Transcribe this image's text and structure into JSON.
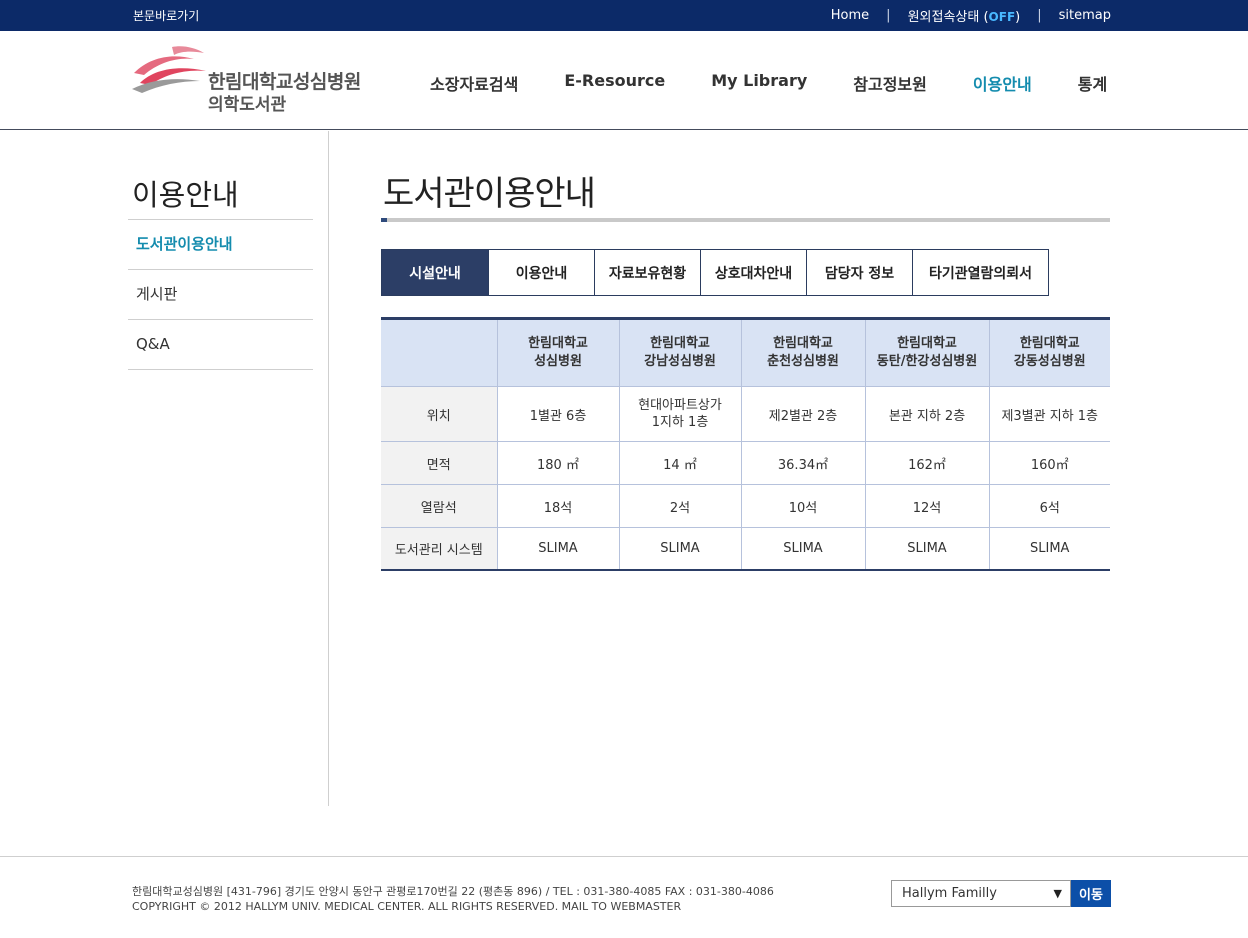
{
  "topbar": {
    "skip": "본문바로가기",
    "home": "Home",
    "remote_label": "원외접속상태",
    "remote_status": "OFF",
    "sitemap": "sitemap"
  },
  "logo": {
    "line1": "한림대학교성심병원",
    "line2": "의학도서관"
  },
  "gnb": [
    "소장자료검색",
    "E-Resource",
    "My Library",
    "참고정보원",
    "이용안내",
    "통계"
  ],
  "sidebar": {
    "title": "이용안내",
    "items": [
      "도서관이용안내",
      "게시판",
      "Q&A"
    ]
  },
  "content": {
    "title": "도서관이용안내",
    "tabs": [
      "시설안내",
      "이용안내",
      "자료보유현황",
      "상호대차안내",
      "담당자 정보",
      "타기관열람의뢰서"
    ]
  },
  "table": {
    "headers": [
      [
        "한림대학교",
        "성심병원"
      ],
      [
        "한림대학교",
        "강남성심병원"
      ],
      [
        "한림대학교",
        "춘천성심병원"
      ],
      [
        "한림대학교",
        "동탄/한강성심병원"
      ],
      [
        "한림대학교",
        "강동성심병원"
      ]
    ],
    "rows": [
      {
        "label": "위치",
        "cells": [
          "1별관 6층",
          "현대아파트상가\n1지하 1층",
          "제2별관 2층",
          "본관 지하 2층",
          "제3별관 지하 1층"
        ]
      },
      {
        "label": "면적",
        "cells": [
          "180 ㎡",
          "14 ㎡",
          "36.34㎡",
          "162㎡",
          "160㎡"
        ]
      },
      {
        "label": "열람석",
        "cells": [
          "18석",
          "2석",
          "10석",
          "12석",
          "6석"
        ]
      },
      {
        "label": "도서관리 시스템",
        "cells": [
          "SLIMA",
          "SLIMA",
          "SLIMA",
          "SLIMA",
          "SLIMA"
        ]
      }
    ]
  },
  "footer": {
    "address": "한림대학교성심병원 [431-796] 경기도 안양시 동안구 관평로170번길 22 (평촌동 896) / TEL : 031-380-4085 FAX : 031-380-4086",
    "copyright": "COPYRIGHT © 2012 HALLYM UNIV. MEDICAL CENTER. ALL RIGHTS RESERVED. MAIL TO WEBMASTER",
    "family_select": "Hallym Familly",
    "go_button": "이동"
  },
  "colors": {
    "topbar": "#0c2a68",
    "accent": "#148cae",
    "tab_active": "#2c3e66",
    "table_header": "#d9e3f4",
    "go_button": "#0c4fa8"
  }
}
